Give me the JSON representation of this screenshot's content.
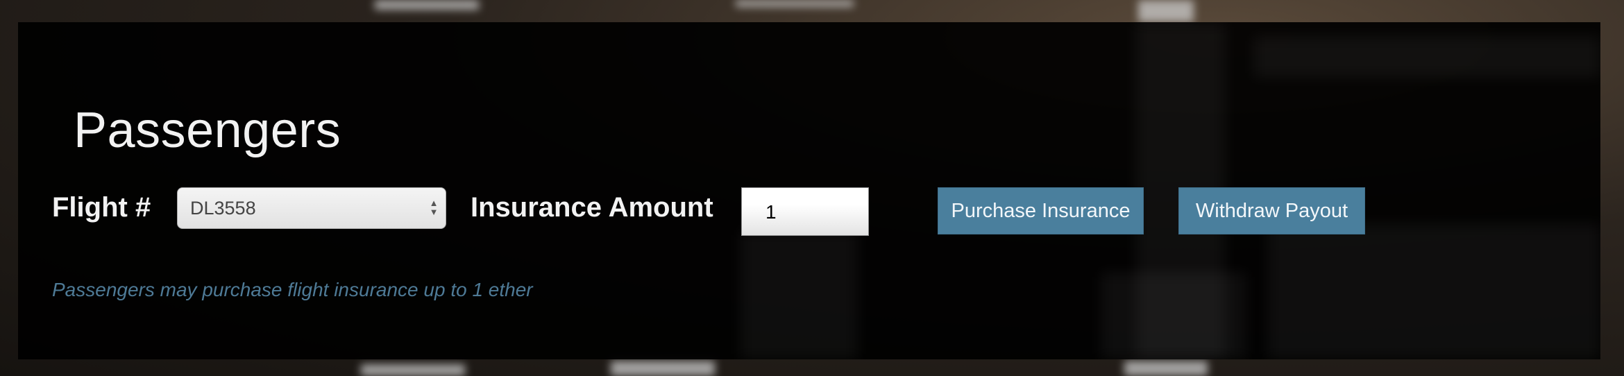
{
  "section": {
    "title": "Passengers"
  },
  "form": {
    "flight_label": "Flight #",
    "flight_select": {
      "selected": "DL3558"
    },
    "amount_label": "Insurance Amount",
    "amount_input": {
      "value": "1"
    },
    "purchase_button": "Purchase Insurance",
    "withdraw_button": "Withdraw Payout"
  },
  "hint": "Passengers may purchase flight insurance up to 1 ether",
  "colors": {
    "button_bg": "#4a7f9d",
    "hint_text": "#4e7a96",
    "panel_bg": "#000000"
  },
  "icons": {
    "select_arrows": "up-down-chevron-icon"
  }
}
